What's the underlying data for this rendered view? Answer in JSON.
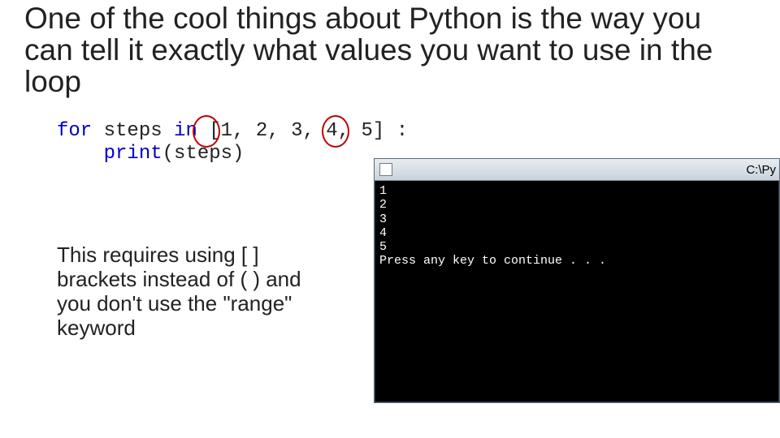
{
  "headline": "One of the cool things about Python is the way you can tell it exactly what values you want to use in the loop",
  "code": {
    "kw_for": "for",
    "seg1": " steps ",
    "kw_in": "in",
    "seg2": " [1, 2, 3, 4, 5] :",
    "indent": "    ",
    "kw_print": "print",
    "seg3": "(steps)"
  },
  "note": "This requires using [ ] brackets instead of ( ) and you don't use the \"range\" keyword",
  "terminal": {
    "title": "C:\\Py",
    "output": "1\n2\n3\n4\n5\nPress any key to continue . . ."
  }
}
